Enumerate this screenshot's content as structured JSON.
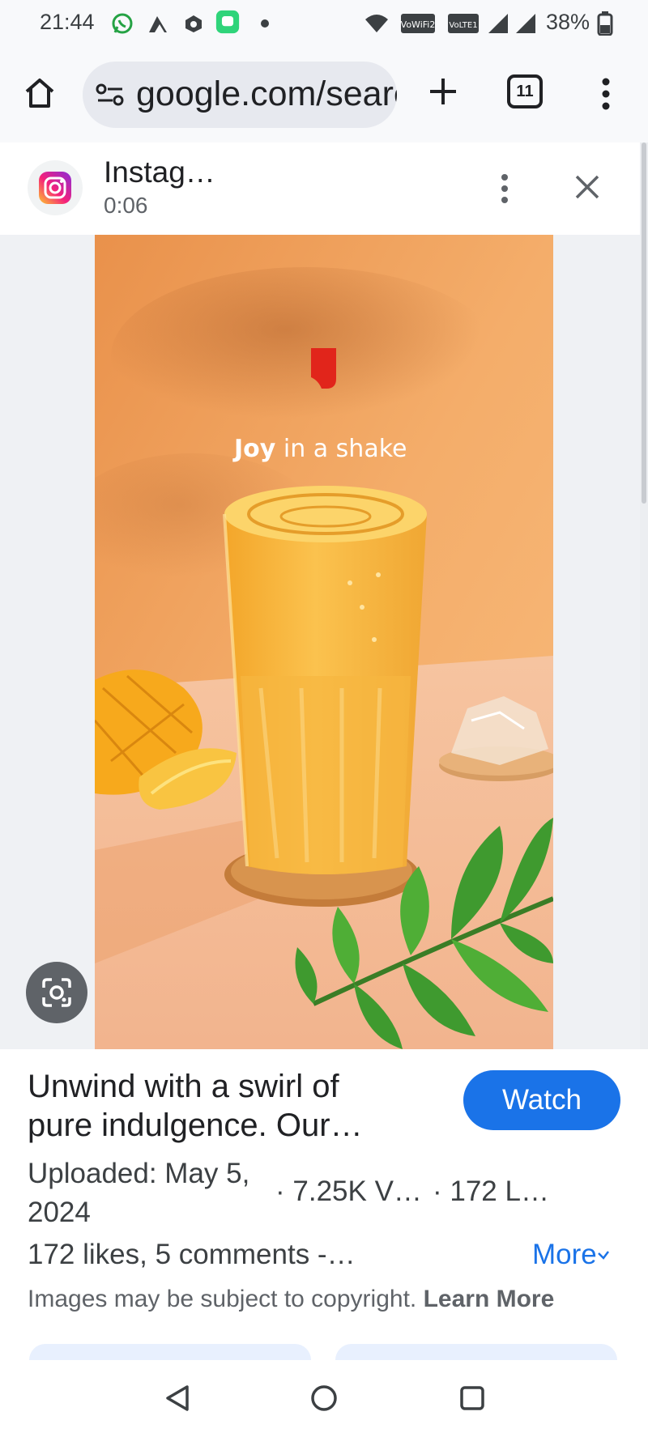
{
  "status_bar": {
    "time": "21:44",
    "battery_percent": "38%",
    "icons": [
      "whatsapp-icon",
      "app-icon",
      "app-icon",
      "chat-app-icon",
      "dot-icon",
      "wifi-icon",
      "vowifi-icon",
      "volte-icon",
      "signal-icon",
      "signal-icon",
      "battery-icon"
    ],
    "wifi_badge": "VoWiFi2",
    "lte_badge": "VoLTE1"
  },
  "browser": {
    "url": "google.com/search",
    "tab_count": "11",
    "icons": [
      "home-icon",
      "site-settings-icon",
      "plus-icon",
      "tabs-icon",
      "more-vert-icon"
    ]
  },
  "source": {
    "name": "Instag…",
    "duration": "0:06",
    "icons": [
      "instagram-icon",
      "more-vert-icon",
      "close-icon"
    ]
  },
  "image": {
    "caption_bold": "Joy",
    "caption_rest": " in a shake",
    "lens_icon": "google-lens-icon"
  },
  "info": {
    "title_line1": "Unwind with a swirl of",
    "title_line2": "pure indulgence. Our…",
    "watch_label": "Watch",
    "uploaded": "Uploaded: May 5, 2024",
    "views": "· 7.25K V…",
    "likes_short": "· 172 L…",
    "description": "172 likes, 5 comments -…",
    "more_label": "More",
    "copyright_text": "Images may be subject to copyright.",
    "learn_more": "Learn More"
  },
  "nav": {
    "icons": [
      "back-icon",
      "home-circle-icon",
      "recents-icon"
    ]
  },
  "colors": {
    "accent": "#1a73e8",
    "photo_background": "#f5b36e",
    "shake": "#f7b23a",
    "logo": "#e1251b"
  }
}
